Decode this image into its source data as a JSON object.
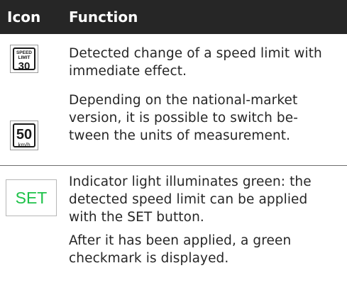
{
  "table": {
    "headers": {
      "icon": "Icon",
      "function": "Function"
    },
    "rows": [
      {
        "icon": {
          "name": "speed-limit-sign-icon",
          "top_text": "SPEED",
          "mid_text": "LIMIT",
          "value": "30"
        },
        "lines": [
          "Detected change of a speed limit with",
          "immediate effect."
        ]
      },
      {
        "icon": {
          "name": "speed-limit-kmh-sign-icon",
          "value": "50",
          "unit": "km/h"
        },
        "lines": [
          "Depending on the national-market",
          "version, it is possible to switch be-",
          "tween the units of measurement."
        ]
      },
      {
        "icon": {
          "name": "set-indicator-icon",
          "label": "SET",
          "color": "#1fc24a"
        },
        "lines": [
          "Indicator light illuminates green: the",
          "detected speed limit can be applied",
          "with the SET button."
        ]
      },
      {
        "lines": [
          "After it has been applied, a green",
          "checkmark is displayed."
        ]
      }
    ]
  }
}
